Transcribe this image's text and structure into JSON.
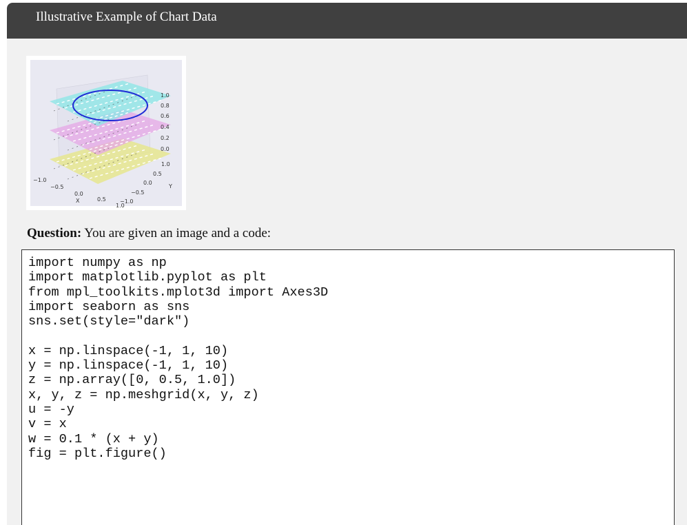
{
  "header": {
    "title": "Illustrative Example of Chart Data"
  },
  "thumbnail": {
    "z_ticks": [
      "1.0",
      "0.8",
      "0.6",
      "0.4",
      "0.2",
      "0.0"
    ],
    "y_ticks": [
      "1.0",
      "0.5",
      "0.0",
      "−0.5",
      "−1.0"
    ],
    "x_ticks": [
      "−1.0",
      "−0.5",
      "0.0",
      "0.5",
      "1.0"
    ],
    "x_label": "X",
    "y_label": "Y",
    "colors": {
      "top": "#8fe6e6",
      "mid": "#e6a7e6",
      "bottom": "#e6e68f",
      "circle": "#1f2bd6",
      "panel": "#e9e9f2"
    }
  },
  "question": {
    "label": "Question:",
    "text": " You are given an image and a code:"
  },
  "code": {
    "lines": [
      "import numpy as np",
      "import matplotlib.pyplot as plt",
      "from mpl_toolkits.mplot3d import Axes3D",
      "import seaborn as sns",
      "sns.set(style=\"dark\")",
      "",
      "x = np.linspace(-1, 1, 10)",
      "y = np.linspace(-1, 1, 10)",
      "z = np.array([0, 0.5, 1.0])",
      "x, y, z = np.meshgrid(x, y, z)",
      "u = -y",
      "v = x",
      "w = 0.1 * (x + y)",
      "fig = plt.figure()"
    ]
  }
}
